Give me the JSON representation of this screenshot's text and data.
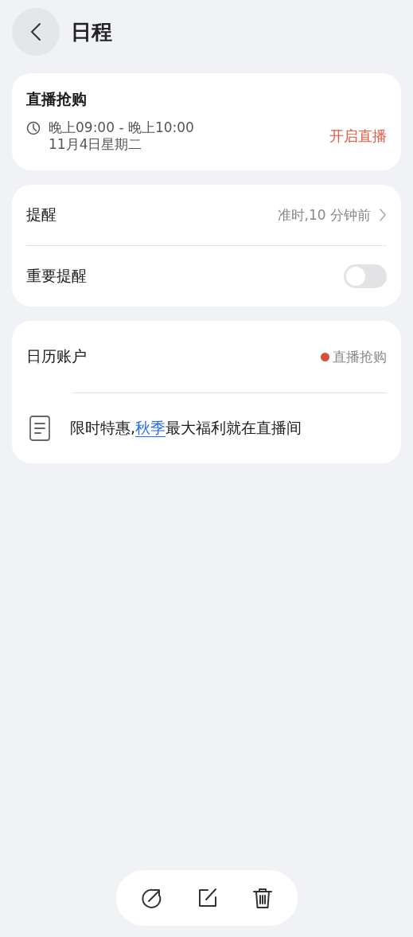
{
  "header": {
    "title": "日程"
  },
  "event": {
    "title": "直播抢购",
    "time": "晚上09:00 - 晚上10:00",
    "date": "11月4日星期二",
    "action": "开启直播"
  },
  "reminders": [
    {
      "kind": "link",
      "label": "提醒",
      "value": "准时,10 分钟前"
    },
    {
      "kind": "switch",
      "label": "重要提醒",
      "on": false
    }
  ],
  "account": {
    "label": "日历账户",
    "value": "直播抢购",
    "color": "#d9503a"
  },
  "note": {
    "before": "限时特惠,",
    "link": "秋季",
    "after": "最大福利就在直播间"
  }
}
